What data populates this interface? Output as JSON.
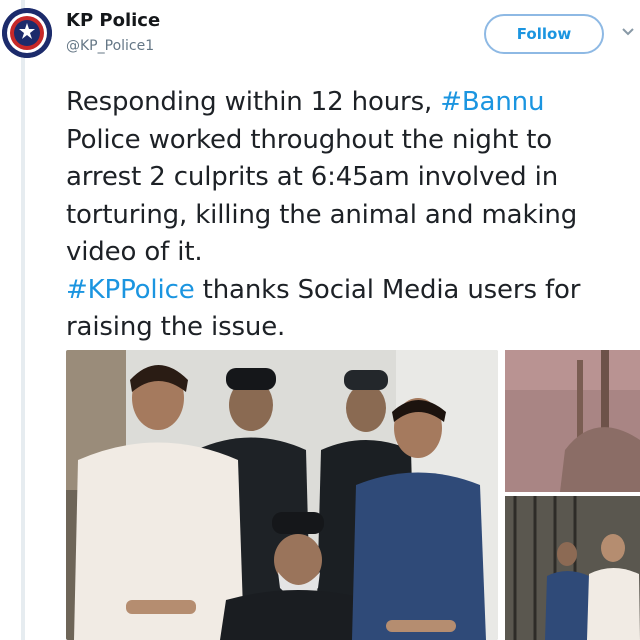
{
  "account": {
    "display_name": "KP Police",
    "handle": "@KP_Police1",
    "avatar_icon": "kp-police-emblem",
    "follow_label": "Follow",
    "menu_icon": "chevron-down-icon"
  },
  "tweet": {
    "line1_a": "Responding within 12 hours, ",
    "hashtag1": "#Bannu",
    "line1_b": "\nPolice worked throughout the night to\narrest 2 culprits at 6:45am involved in\ntorturing, killing the animal and making\nvideo of it.\n",
    "hashtag2": "#KPPolice",
    "line2": " thanks Social Media users for\nraising the issue."
  },
  "media": {
    "main_photo": "photo-arrested-culprits-with-police",
    "top_right_photo": "photo-outdoor-scene",
    "bottom_right_photo": "photo-lockup"
  },
  "colors": {
    "link": "#1b95e0",
    "text": "#1d2126",
    "muted": "#657786",
    "brand": "#1c2b6b"
  }
}
